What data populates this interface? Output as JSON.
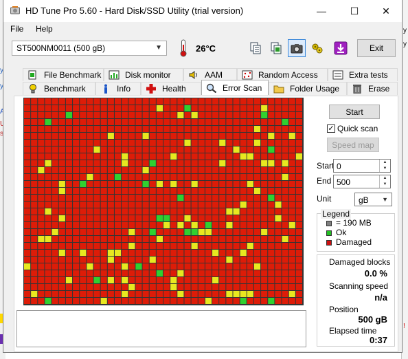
{
  "window": {
    "title": "HD Tune Pro 5.60 - Hard Disk/SSD Utility (trial version)",
    "minimize_glyph": "—",
    "maximize_glyph": "☐",
    "close_glyph": "✕"
  },
  "menu": [
    "File",
    "Help"
  ],
  "toolbar": {
    "drive": "ST500NM0011 (500 gB)",
    "temperature": "26°C",
    "icons": [
      "copy-text-icon",
      "copy-info-icon",
      "screenshot-icon",
      "options-icon",
      "save-icon"
    ],
    "exit_label": "Exit"
  },
  "tabs": {
    "top_row": [
      "File Benchmark",
      "Disk monitor",
      "AAM",
      "Random Access",
      "Extra tests"
    ],
    "bottom_row": [
      "Benchmark",
      "Info",
      "Health",
      "Error Scan",
      "Folder Usage",
      "Erase"
    ],
    "selected": "Error Scan"
  },
  "scan_controls": {
    "start_label": "Start",
    "quick_scan_label": "Quick scan",
    "quick_scan_checked": true,
    "speed_map_label": "Speed map",
    "start_field_label": "Start",
    "start_value": "0",
    "end_field_label": "End",
    "end_value": "500",
    "unit_label": "Unit",
    "unit_value": "gB"
  },
  "legend": {
    "title": "Legend",
    "items": [
      {
        "label": "= 190 MB",
        "color": "#808080"
      },
      {
        "label": "Ok",
        "color": "#22c022"
      },
      {
        "label": "Damaged",
        "color": "#cc1010"
      }
    ]
  },
  "stats": {
    "damaged_blocks_label": "Damaged blocks",
    "damaged_blocks_value": "0.0 %",
    "scanning_speed_label": "Scanning speed",
    "scanning_speed_value": "n/a",
    "position_label": "Position",
    "position_value": "500 gB",
    "elapsed_label": "Elapsed time",
    "elapsed_value": "0:37"
  },
  "block_map": {
    "damaged_color": "#dd1c08",
    "warning_color": "#e8e820",
    "ok_color": "#30d030",
    "grid_color": "#343434",
    "damaged_fraction": 0.91,
    "warning_fraction": 0.075,
    "ok_fraction": 0.015
  },
  "background_app": {
    "left_marks": [
      "y",
      "y",
      "A",
      "U",
      "se"
    ],
    "right_marks": [
      "y",
      "y",
      "!"
    ]
  }
}
